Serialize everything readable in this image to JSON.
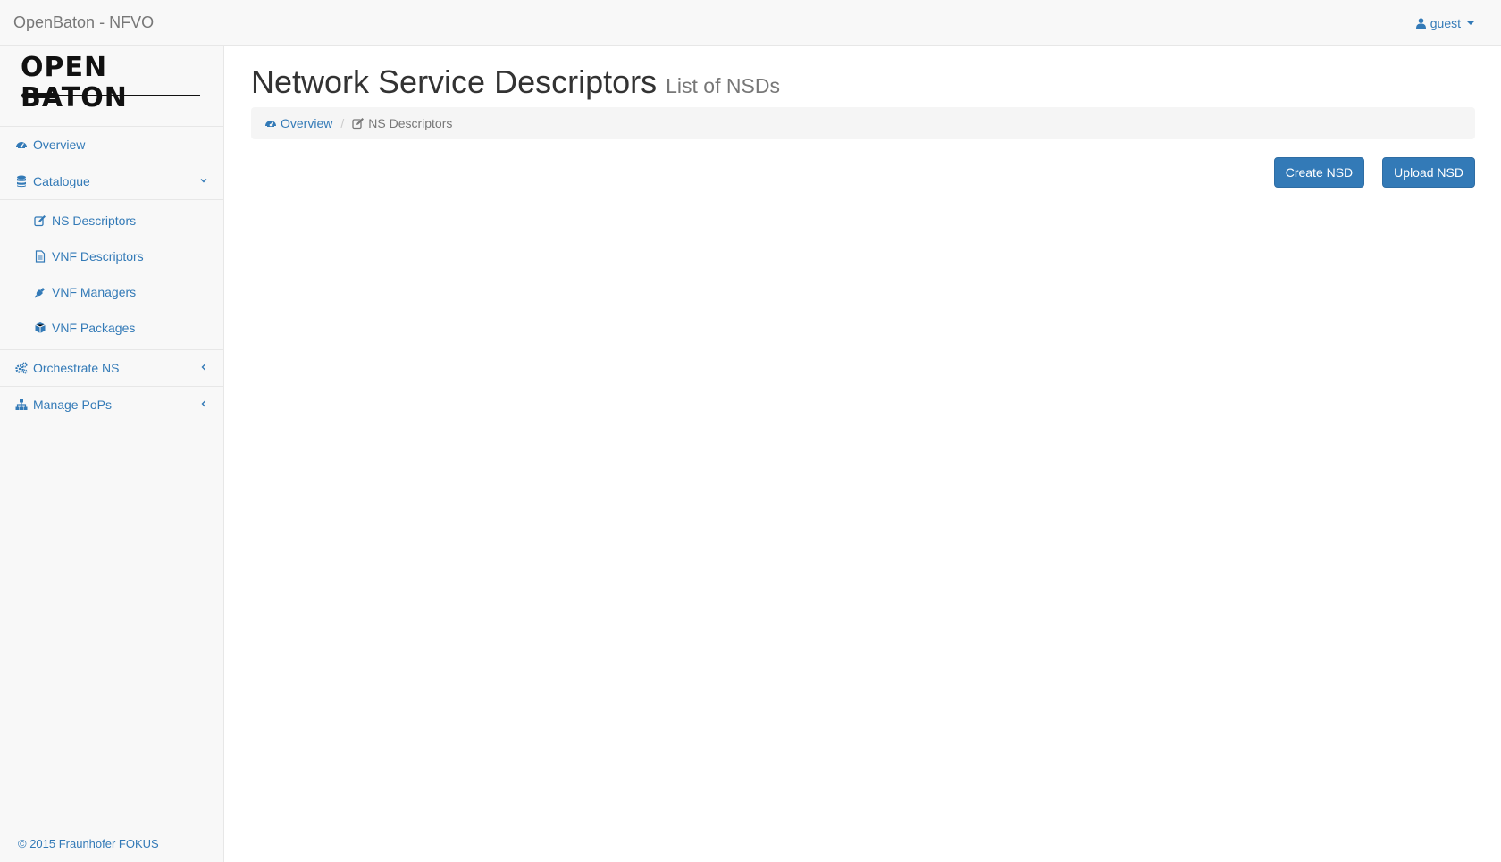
{
  "navbar": {
    "brand": "OpenBaton - NFVO",
    "user": "guest"
  },
  "sidebar": {
    "logo_text": "OPEN BATON",
    "items": [
      {
        "label": "Overview",
        "icon": "dashboard-icon"
      },
      {
        "label": "Catalogue",
        "icon": "database-icon",
        "expanded": true,
        "children": [
          {
            "label": "NS Descriptors",
            "icon": "edit-icon"
          },
          {
            "label": "VNF Descriptors",
            "icon": "file-text-icon"
          },
          {
            "label": "VNF Managers",
            "icon": "plug-icon"
          },
          {
            "label": "VNF Packages",
            "icon": "cube-icon"
          }
        ]
      },
      {
        "label": "Orchestrate NS",
        "icon": "cogs-icon",
        "expanded": false
      },
      {
        "label": "Manage PoPs",
        "icon": "sitemap-icon",
        "expanded": false
      }
    ],
    "copyright": "© 2015 Fraunhofer FOKUS"
  },
  "main": {
    "title": "Network Service Descriptors",
    "subtitle": "List of NSDs",
    "breadcrumb": [
      {
        "label": "Overview",
        "icon": "dashboard-icon",
        "link": true
      },
      {
        "label": "NS Descriptors",
        "icon": "edit-icon",
        "link": false
      }
    ],
    "buttons": {
      "create": "Create NSD",
      "upload": "Upload NSD"
    }
  },
  "colors": {
    "link": "#337ab7",
    "button": "#337ab7",
    "navbar_bg": "#f8f8f8",
    "breadcrumb_bg": "#f5f5f5"
  }
}
